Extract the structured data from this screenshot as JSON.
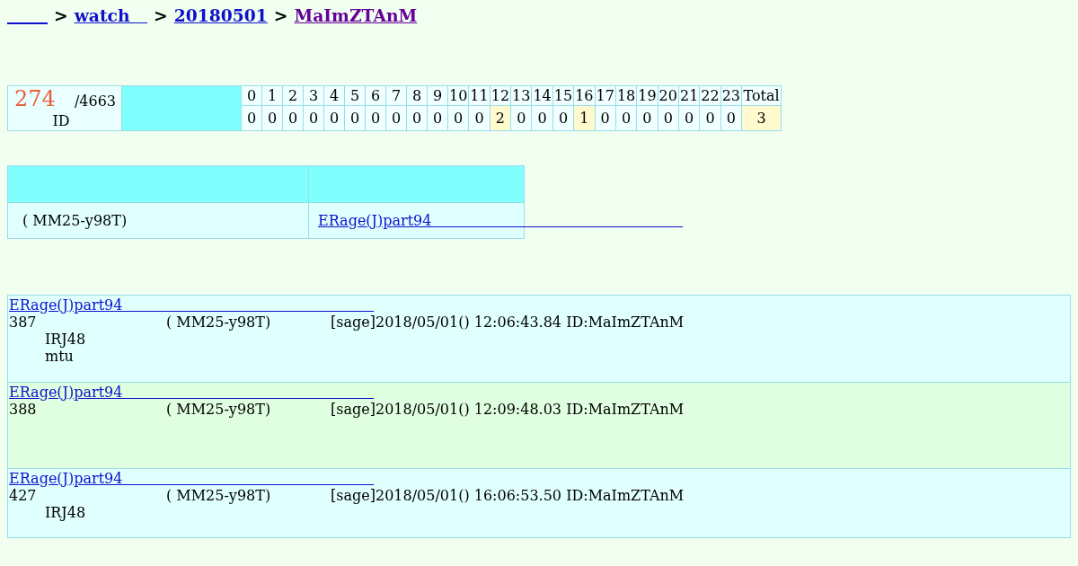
{
  "breadcrumb": [
    {
      "kind": "blank_link",
      "visited": false
    },
    {
      "kind": "separator",
      "label": ">"
    },
    {
      "kind": "link",
      "label": "watch   ",
      "visited": false
    },
    {
      "kind": "separator",
      "label": ">"
    },
    {
      "kind": "link",
      "label": "20180501",
      "visited": false
    },
    {
      "kind": "separator",
      "label": ">"
    },
    {
      "kind": "link",
      "label": "MaImZTAnM",
      "visited": true
    }
  ],
  "stats": {
    "count": "274",
    "of_total": "/4663",
    "label": "ID",
    "hours": [
      {
        "label": "0",
        "count": "0",
        "highlighted": false
      },
      {
        "label": "1",
        "count": "0",
        "highlighted": false
      },
      {
        "label": "2",
        "count": "0",
        "highlighted": false
      },
      {
        "label": "3",
        "count": "0",
        "highlighted": false
      },
      {
        "label": "4",
        "count": "0",
        "highlighted": false
      },
      {
        "label": "5",
        "count": "0",
        "highlighted": false
      },
      {
        "label": "6",
        "count": "0",
        "highlighted": false
      },
      {
        "label": "7",
        "count": "0",
        "highlighted": false
      },
      {
        "label": "8",
        "count": "0",
        "highlighted": false
      },
      {
        "label": "9",
        "count": "0",
        "highlighted": false
      },
      {
        "label": "10",
        "count": "0",
        "highlighted": false
      },
      {
        "label": "11",
        "count": "0",
        "highlighted": false
      },
      {
        "label": "12",
        "count": "2",
        "highlighted": true
      },
      {
        "label": "13",
        "count": "0",
        "highlighted": false
      },
      {
        "label": "14",
        "count": "0",
        "highlighted": false
      },
      {
        "label": "15",
        "count": "0",
        "highlighted": false
      },
      {
        "label": "16",
        "count": "1",
        "highlighted": true
      },
      {
        "label": "17",
        "count": "0",
        "highlighted": false
      },
      {
        "label": "18",
        "count": "0",
        "highlighted": false
      },
      {
        "label": "19",
        "count": "0",
        "highlighted": false
      },
      {
        "label": "20",
        "count": "0",
        "highlighted": false
      },
      {
        "label": "21",
        "count": "0",
        "highlighted": false
      },
      {
        "label": "22",
        "count": "0",
        "highlighted": false
      },
      {
        "label": "23",
        "count": "0",
        "highlighted": false
      }
    ],
    "total_column": {
      "label": "Total",
      "count": "3",
      "highlighted": true
    }
  },
  "info_table": {
    "rows": [
      {
        "cells": [
          {
            "kind": "text",
            "text": "( MM25-y98T)"
          },
          {
            "kind": "link",
            "text": "ERage(J)part94                                                       "
          }
        ]
      }
    ]
  },
  "posts": [
    {
      "title": "ERage(J)part94                                                       ",
      "number": "387",
      "name": "( MM25-y98T)",
      "meta": "[sage]2018/05/01() 12:06:43.84 ID:MaImZTAnM",
      "body": [
        "IRJ48",
        "mtu"
      ],
      "color": "#e0ffff"
    },
    {
      "title": "ERage(J)part94                                                       ",
      "number": "388",
      "name": "( MM25-y98T)",
      "meta": "[sage]2018/05/01() 12:09:48.03 ID:MaImZTAnM",
      "color": "#e0ffe0"
    },
    {
      "title": "ERage(J)part94                                                       ",
      "number": "427",
      "name": "( MM25-y98T)",
      "meta": "[sage]2018/05/01() 16:06:53.50 ID:MaImZTAnM",
      "body": [
        "IRJ48"
      ],
      "color": "#e0ffff"
    }
  ]
}
